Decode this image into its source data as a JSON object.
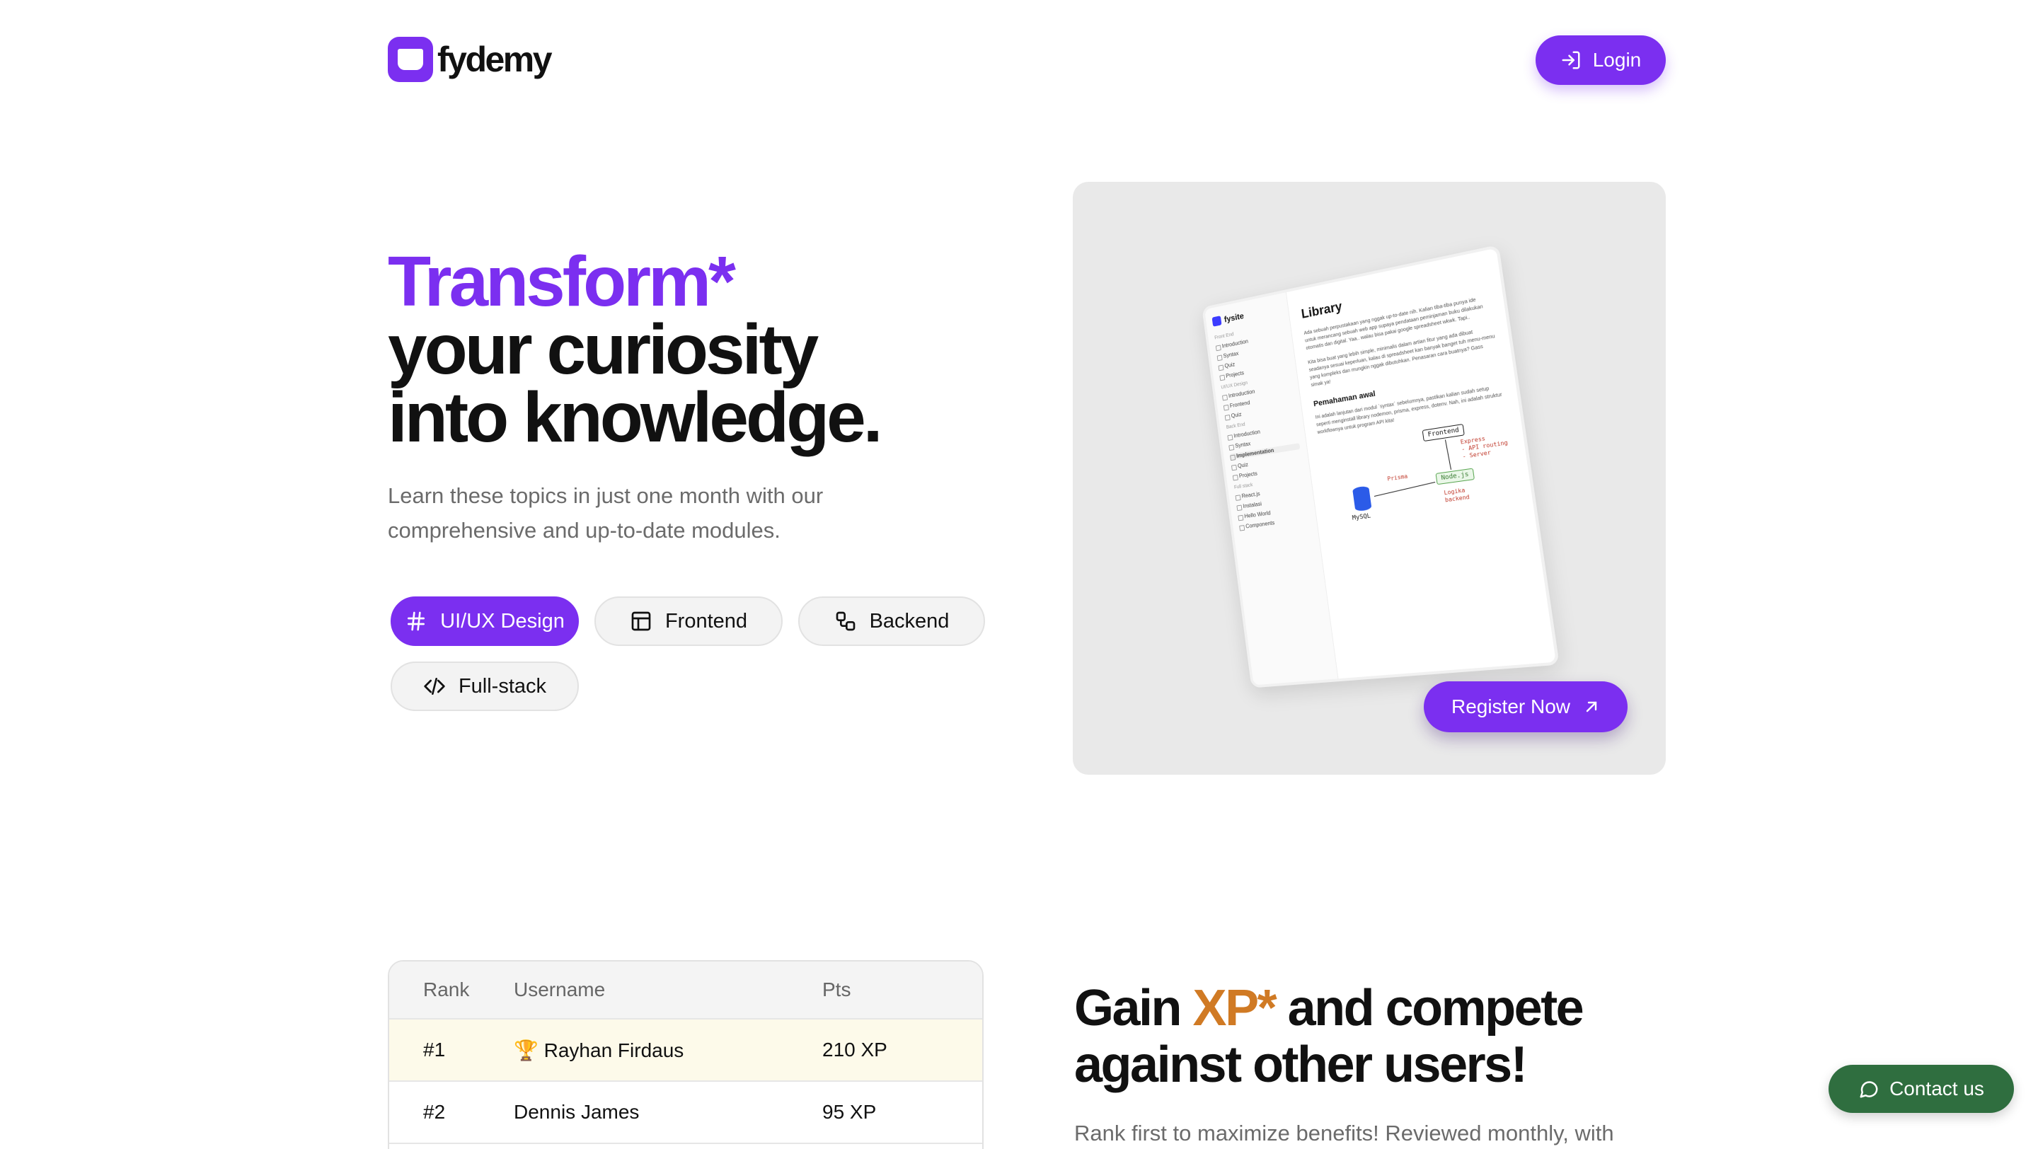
{
  "header": {
    "brand": "fydemy",
    "login_label": "Login"
  },
  "hero": {
    "title_accent": "Transform*",
    "title_line2": "your curiosity",
    "title_line3": "into knowledge.",
    "subtitle": "Learn these topics in just one month with our comprehensive and up-to-date modules.",
    "topics": [
      {
        "label": "UI/UX Design",
        "icon": "hash-icon",
        "active": true
      },
      {
        "label": "Frontend",
        "icon": "layout-icon",
        "active": false
      },
      {
        "label": "Backend",
        "icon": "nodes-icon",
        "active": false
      },
      {
        "label": "Full-stack",
        "icon": "code-icon",
        "active": false
      }
    ]
  },
  "preview": {
    "app_name": "fysite",
    "sidebar": {
      "sections": [
        {
          "title": "Front End",
          "items": [
            "Introduction",
            "Syntax",
            "Quiz",
            "Projects"
          ]
        },
        {
          "title": "UI/UX Design",
          "items": [
            "Introduction",
            "Frontend",
            "Quiz"
          ]
        },
        {
          "title": "Back End",
          "items": [
            "Introduction",
            "Syntax",
            "Implementation",
            "Quiz",
            "Projects"
          ]
        },
        {
          "title": "Full stack",
          "items": [
            "React.js",
            "Instalasi",
            "Hello World",
            "Components"
          ]
        }
      ]
    },
    "doc_title": "Library",
    "doc_para1": "Ada sebuah perpustakaan yang nggak up-to-date nih. Kalian tiba-tiba punya ide untuk merancang sebuah web app supaya pendataan peminjaman buku dilakukan otomatis dan digital. Yaa.. walau bisa pakai google spreadsheet wkwk. Tapi..",
    "doc_para2": "Kita bisa buat yang lebih simple, minimalis dalam artian fitur yang ada dibuat seadanya sesuai keperluan, kalau di spreadsheet kan banyak banget tuh menu-menu yang kompleks dan mungkin nggak dibutuhkan. Penasaran cara buatnya? Gass simak ya!",
    "doc_section": "Pemahaman awal",
    "doc_para3": "Ini adalah lanjutan dari modul `syntax` sebelumnya, pastikan kalian sudah setup seperti menginstall library nodemon, prisma, express, dotenv. Nah, ini adalah struktur workflownya untuk program API kita!",
    "diagram": {
      "frontend": "Frontend",
      "nodejs": "Node.js",
      "mysql": "MySQL",
      "prisma": "Prisma",
      "notes_express": "Express\n- API routing\n- Server",
      "notes_logic": "Logika\nbackend"
    },
    "register_label": "Register Now"
  },
  "leaderboard": {
    "headers": {
      "rank": "Rank",
      "username": "Username",
      "pts": "Pts"
    },
    "rows": [
      {
        "rank": "#1",
        "username": "🏆 Rayhan Firdaus",
        "pts": "210 XP"
      },
      {
        "rank": "#2",
        "username": "Dennis James",
        "pts": "95 XP"
      }
    ]
  },
  "gain": {
    "title_pre": "Gain ",
    "title_xp": "XP*",
    "title_post": " and compete",
    "title_line2": "against other users!",
    "subtitle": "Rank first to maximize benefits! Reviewed monthly, with"
  },
  "contact": {
    "label": "Contact us"
  },
  "colors": {
    "primary": "#7b2ff0",
    "xp_accent": "#d07a24",
    "contact": "#2f6e3f"
  }
}
